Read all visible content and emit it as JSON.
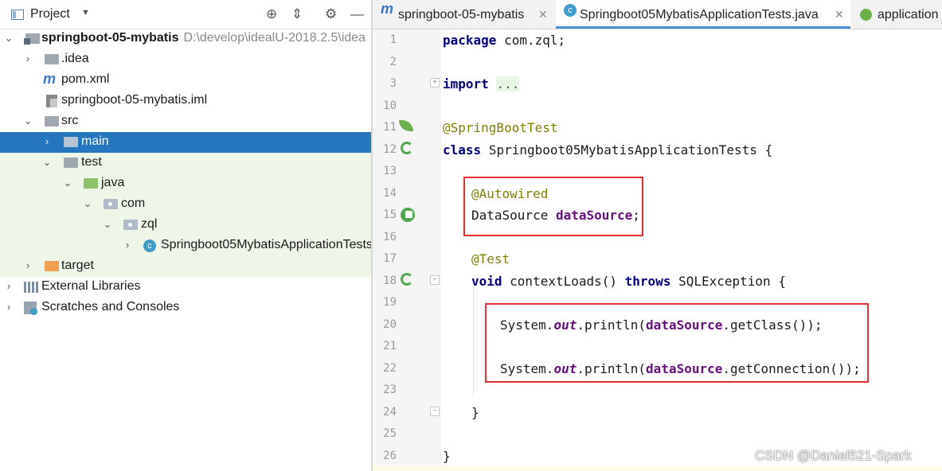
{
  "project_panel": {
    "title": "Project",
    "tree": [
      {
        "label": "springboot-05-mybatis",
        "path": "D:\\develop\\idealU-2018.2.5\\idea",
        "bold": true
      },
      {
        "label": ".idea"
      },
      {
        "label": "pom.xml"
      },
      {
        "label": "springboot-05-mybatis.iml"
      },
      {
        "label": "src"
      },
      {
        "label": "main"
      },
      {
        "label": "test"
      },
      {
        "label": "java"
      },
      {
        "label": "com"
      },
      {
        "label": "zql"
      },
      {
        "label": "Springboot05MybatisApplicationTests"
      },
      {
        "label": "target"
      },
      {
        "label": "External Libraries"
      },
      {
        "label": "Scratches and Consoles"
      }
    ]
  },
  "tabs": [
    {
      "label": "springboot-05-mybatis",
      "icon": "maven-icon"
    },
    {
      "label": "Springboot05MybatisApplicationTests.java",
      "icon": "test-class-icon",
      "active": true
    },
    {
      "label": "application",
      "icon": "spring-icon"
    }
  ],
  "editor": {
    "line_numbers": [
      "1",
      "2",
      "3",
      "10",
      "11",
      "12",
      "13",
      "14",
      "15",
      "16",
      "17",
      "18",
      "19",
      "20",
      "21",
      "22",
      "23",
      "24",
      "25",
      "26"
    ],
    "code": {
      "pkg_kw": "package",
      "pkg_name": " com.zql;",
      "import_kw": "import",
      "import_fold": "...",
      "ann_sbt": "@SpringBootTest",
      "class_kw": "class",
      "class_name": " Springboot05MybatisApplicationTests {",
      "ann_autowired": "@Autowired",
      "ds_type": "DataSource ",
      "ds_field": "dataSource",
      "semicolon": ";",
      "ann_test": "@Test",
      "void_kw": "void",
      "method": " contextLoads() ",
      "throws_kw": "throws",
      "exc": " SQLException {",
      "sys": "System.",
      "out": "out",
      "println": ".println(",
      "field": "dataSource",
      "getclass": ".getClass());",
      "getconn": ".getConnection());",
      "close_brace": "}"
    }
  },
  "watermark": "CSDN @Daniel521-Spark"
}
